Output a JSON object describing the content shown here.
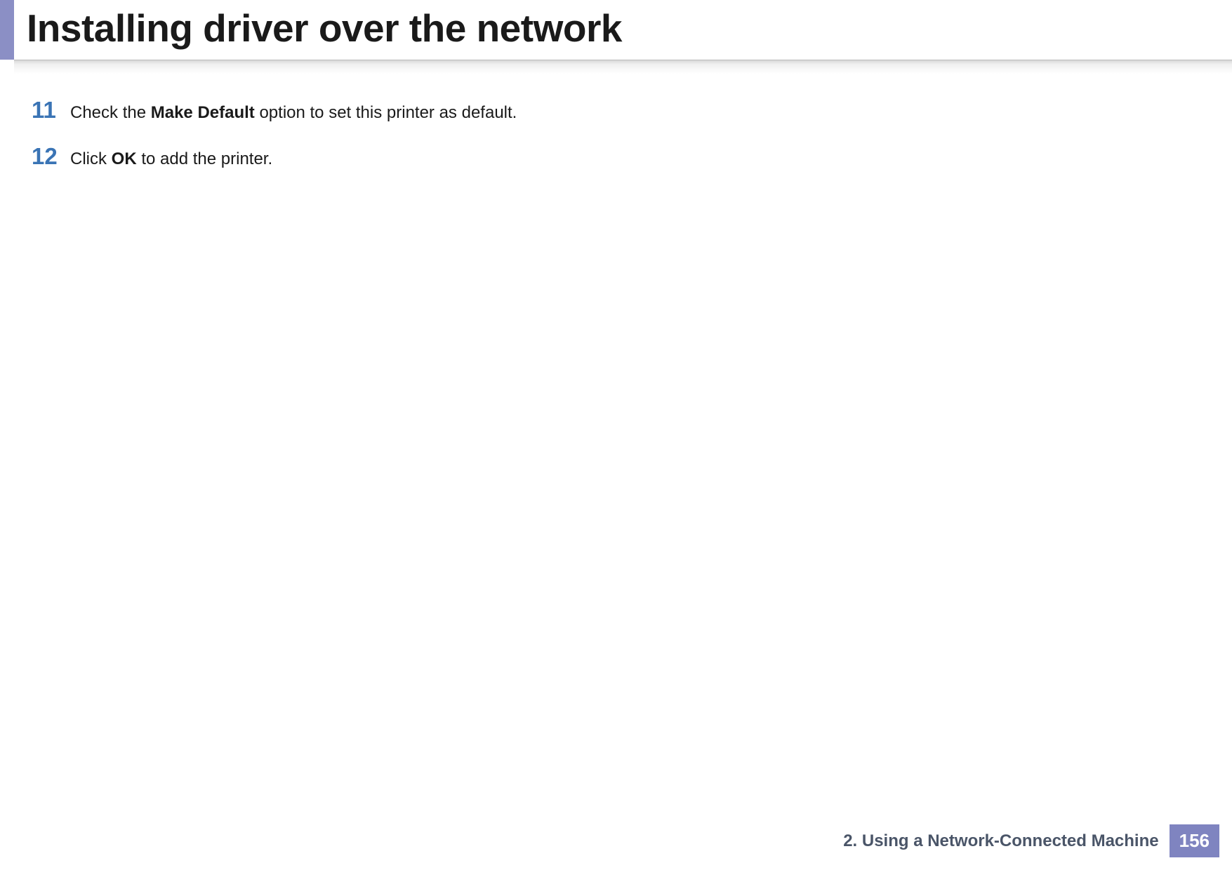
{
  "header": {
    "title": "Installing driver over the network"
  },
  "steps": [
    {
      "number": "11",
      "text_before": "Check the ",
      "text_bold": "Make Default",
      "text_after": " option to set this printer as default."
    },
    {
      "number": "12",
      "text_before": "Click ",
      "text_bold": "OK",
      "text_after": " to add the printer."
    }
  ],
  "footer": {
    "chapter": "2.  Using a Network-Connected Machine",
    "page_number": "156"
  }
}
